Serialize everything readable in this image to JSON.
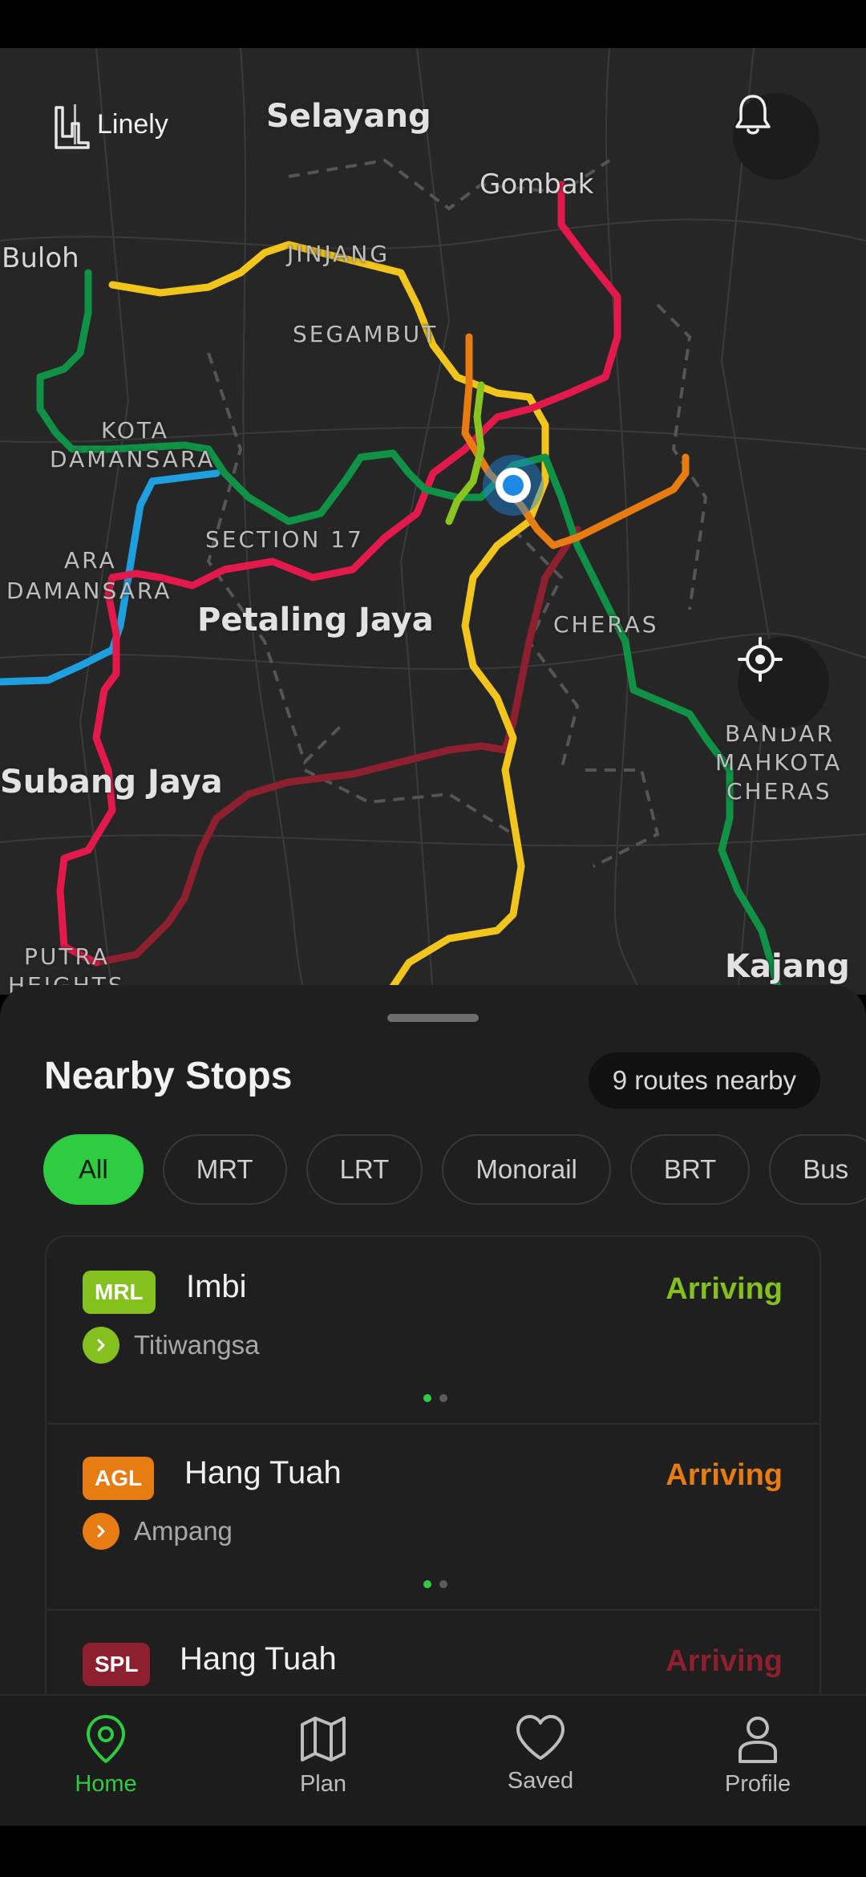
{
  "app": {
    "name": "Linely"
  },
  "map": {
    "labels": {
      "selayang": "Selayang",
      "gombak": "Gombak",
      "buloh": "Buloh",
      "jinjang": "JINJANG",
      "segambut": "SEGAMBUT",
      "kota1": "KOTA",
      "kota2": "DAMANSARA",
      "section17": "SECTION 17",
      "ara1": "ARA",
      "ara2": "DAMANSARA",
      "petaling": "Petaling Jaya",
      "cheras": "CHERAS",
      "bandar1": "BANDAR",
      "bandar2": "MAHKOTA",
      "bandar3": "CHERAS",
      "subang": "Subang Jaya",
      "putra1": "PUTRA",
      "putra2": "HEIGHTS",
      "kajang": "Kajang"
    },
    "line_colors": {
      "yellow": "#f2c51c",
      "red": "#e2194a",
      "green": "#0f9146",
      "blue": "#1ea0e0",
      "orange": "#e77c12",
      "lime": "#8ac420",
      "maroon": "#8e1f2e"
    }
  },
  "header": {
    "bell_icon": "bell-icon",
    "locate_icon": "crosshair-icon"
  },
  "sheet": {
    "title": "Nearby Stops",
    "routes_nearby": "9 routes nearby",
    "filters": [
      "All",
      "MRT",
      "LRT",
      "Monorail",
      "BRT",
      "Bus"
    ],
    "active_filter": "All",
    "stops": [
      {
        "code": "MRL",
        "name": "Imbi",
        "status": "Arriving",
        "destination": "Titiwangsa",
        "color": "#84c11f"
      },
      {
        "code": "AGL",
        "name": "Hang Tuah",
        "status": "Arriving",
        "destination": "Ampang",
        "color": "#e77c12"
      },
      {
        "code": "SPL",
        "name": "Hang Tuah",
        "status": "Arriving",
        "destination": "",
        "color": "#8e1f2e"
      }
    ]
  },
  "nav": {
    "items": [
      {
        "label": "Home",
        "icon": "location-pin-icon"
      },
      {
        "label": "Plan",
        "icon": "map-icon"
      },
      {
        "label": "Saved",
        "icon": "heart-icon"
      },
      {
        "label": "Profile",
        "icon": "user-icon"
      }
    ],
    "active": "Home",
    "accent": "#2ecc40"
  }
}
